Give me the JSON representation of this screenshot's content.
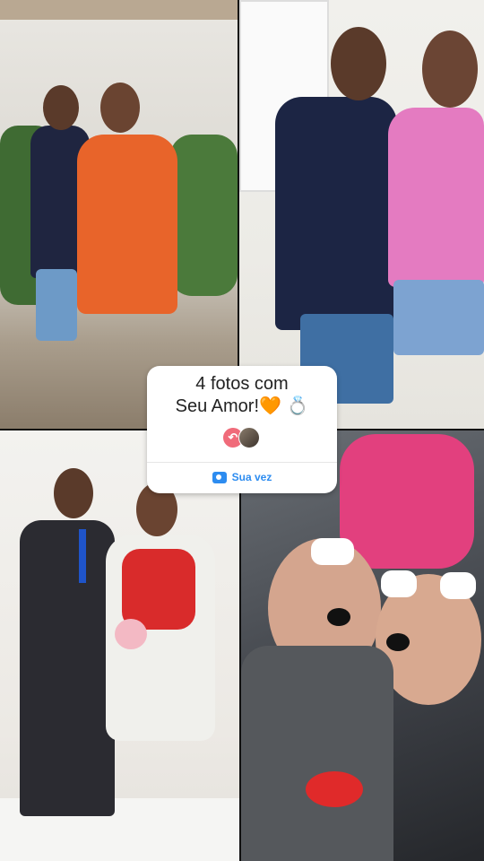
{
  "sticker": {
    "title_line1": "4 fotos com",
    "title_line2": "Seu Amor!🧡 💍",
    "action_label": "Sua vez",
    "undo_glyph": "↶"
  },
  "icons": {
    "undo": "undo-arrow-icon",
    "camera": "camera-icon",
    "avatar": "user-avatar"
  },
  "colors": {
    "accent": "#2d8cf0",
    "undo_badge": "#f06b7a"
  }
}
